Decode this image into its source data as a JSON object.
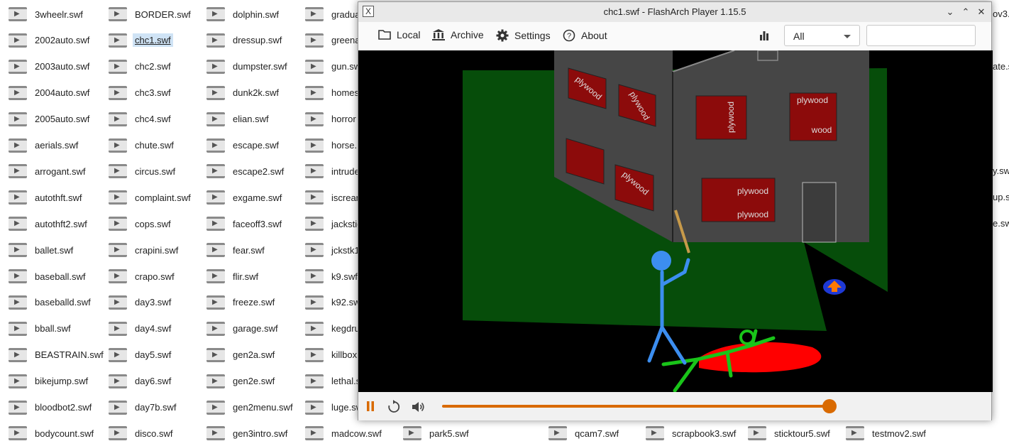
{
  "files": {
    "columns": [
      [
        "3wheelr.swf",
        "2002auto.swf",
        "2003auto.swf",
        "2004auto.swf",
        "2005auto.swf",
        "aerials.swf",
        "arrogant.swf",
        "autothft.swf",
        "autothft2.swf",
        "ballet.swf",
        "baseball.swf",
        "baseballd.swf",
        "bball.swf",
        "BEASTRAIN.swf",
        "bikejump.swf",
        "bloodbot2.swf",
        "bodycount.swf"
      ],
      [
        "BORDER.swf",
        "chc1.swf",
        "chc2.swf",
        "chc3.swf",
        "chc4.swf",
        "chute.swf",
        "circus.swf",
        "complaint.swf",
        "cops.swf",
        "crapini.swf",
        "crapo.swf",
        "day3.swf",
        "day4.swf",
        "day5.swf",
        "day6.swf",
        "day7b.swf",
        "disco.swf"
      ],
      [
        "dolphin.swf",
        "dressup.swf",
        "dumpster.swf",
        "dunk2k.swf",
        "elian.swf",
        "escape.swf",
        "escape2.swf",
        "exgame.swf",
        "faceoff3.swf",
        "fear.swf",
        "flir.swf",
        "freeze.swf",
        "garage.swf",
        "gen2a.swf",
        "gen2e.swf",
        "gen2menu.swf",
        "gen3intro.swf"
      ],
      [
        "gradua",
        "greena",
        "gun.swf",
        "homes",
        "horror",
        "horse.",
        "intrude",
        "iscream",
        "jackstic",
        "jckstk1",
        "k9.swf",
        "k92.swf",
        "kegdru",
        "killbox",
        "lethal.s",
        "luge.sw",
        "madcow.swf"
      ]
    ],
    "bottom_extra": [
      "park5.swf",
      "qcam7.swf",
      "scrapbook3.swf",
      "sticktour5.swf",
      "testmov2.swf"
    ],
    "right_edge": [
      "ov3.",
      "",
      "ate.s",
      "",
      "",
      "",
      "y.sw",
      "up.sv",
      "e.sw"
    ],
    "selected": "chc1.swf"
  },
  "window": {
    "title": "chc1.swf - FlashArch Player 1.15.5",
    "app_icon": "X"
  },
  "toolbar": {
    "local": "Local",
    "archive": "Archive",
    "settings": "Settings",
    "about": "About",
    "filter_value": "All",
    "search_value": ""
  },
  "scene": {
    "labels": [
      "plywood",
      "plywood",
      "plywood",
      "plywood",
      "wood",
      "plywood",
      "plywood",
      "plywood"
    ]
  },
  "playback": {
    "state": "playing",
    "progress_fraction": 0.99
  },
  "colors": {
    "accent": "#d96a00",
    "selection": "#cfe3f5"
  }
}
